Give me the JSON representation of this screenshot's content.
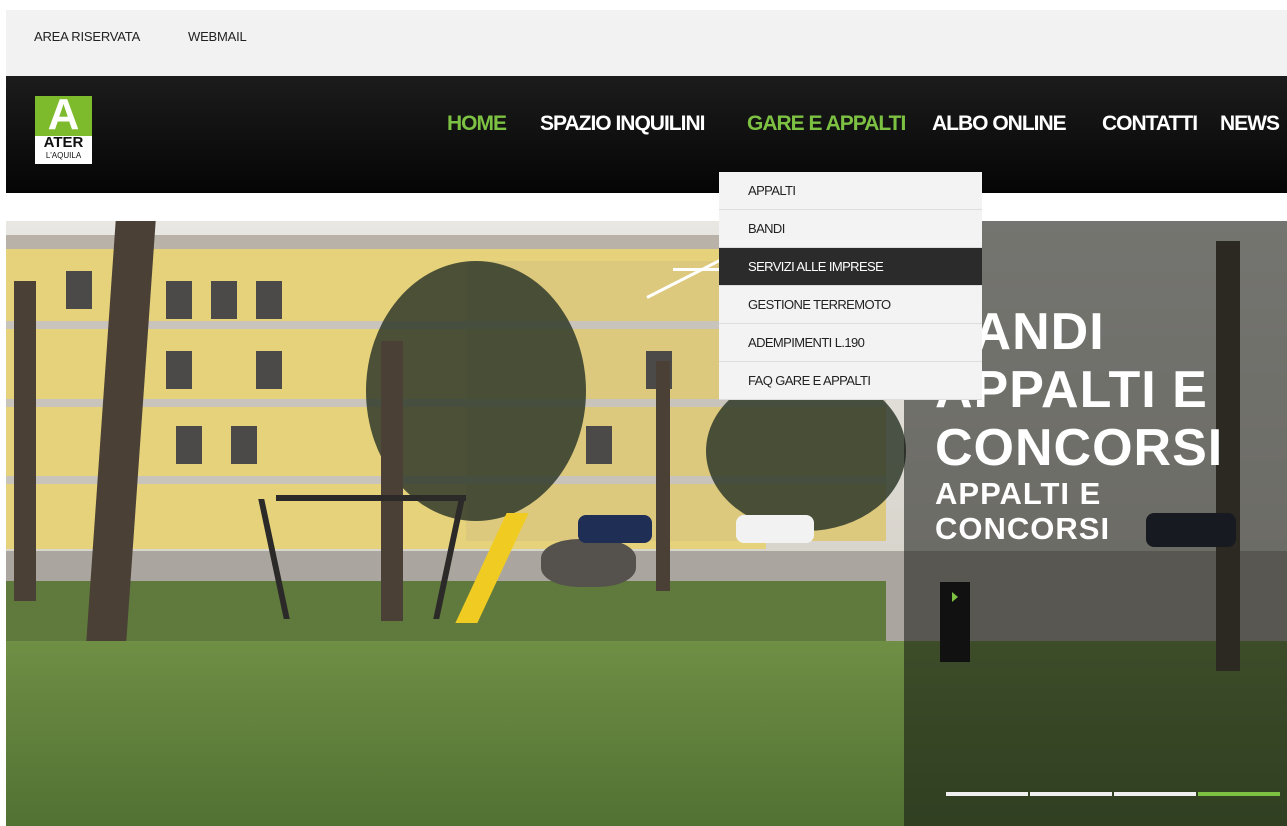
{
  "top_links": [
    "AREA RISERVATA",
    "WEBMAIL"
  ],
  "logo": {
    "text": "ATER",
    "subtext": "L'AQUILA",
    "alt": "ATER L'Aquila logo"
  },
  "menu": [
    "HOME",
    "SPAZIO INQUILINI",
    "GARE E APPALTI",
    "ALBO ONLINE",
    "CONTATTI",
    "NEWS"
  ],
  "menu_active": [
    "HOME",
    "GARE E APPALTI"
  ],
  "dropdown": {
    "items": [
      "APPALTI",
      "BANDI",
      "SERVIZI ALLE IMPRESE",
      "GESTIONE TERREMOTO",
      "ADEMPIMENTI L.190",
      "FAQ GARE E APPALTI"
    ],
    "highlighted": "SERVIZI ALLE IMPRESE"
  },
  "hero": {
    "headline_lines": [
      "BANDI",
      "APPALTI E",
      "CONCORSI"
    ],
    "sub_lines": [
      "APPALTI E",
      "CONCORSI"
    ],
    "slide_count": 4,
    "active_slide": 4
  },
  "colors": {
    "accent": "#7dc143",
    "nav_bg": "#0f0f0f",
    "topbar_bg": "#f2f2f2",
    "dropdown_active": "#2b2b2b"
  }
}
